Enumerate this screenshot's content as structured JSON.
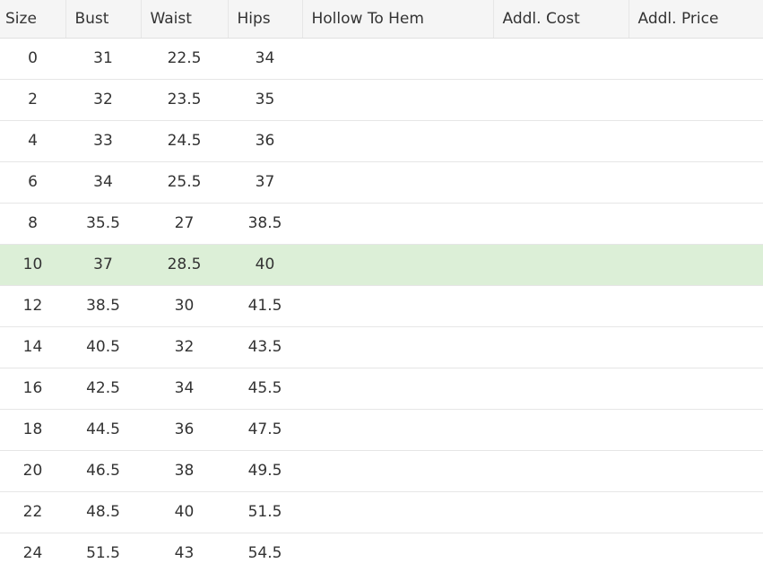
{
  "table": {
    "headers": [
      "Size",
      "Bust",
      "Waist",
      "Hips",
      "Hollow To Hem",
      "Addl. Cost",
      "Addl. Price"
    ],
    "rows": [
      [
        "0",
        "31",
        "22.5",
        "34",
        "",
        "",
        ""
      ],
      [
        "2",
        "32",
        "23.5",
        "35",
        "",
        "",
        ""
      ],
      [
        "4",
        "33",
        "24.5",
        "36",
        "",
        "",
        ""
      ],
      [
        "6",
        "34",
        "25.5",
        "37",
        "",
        "",
        ""
      ],
      [
        "8",
        "35.5",
        "27",
        "38.5",
        "",
        "",
        ""
      ],
      [
        "10",
        "37",
        "28.5",
        "40",
        "",
        "",
        ""
      ],
      [
        "12",
        "38.5",
        "30",
        "41.5",
        "",
        "",
        ""
      ],
      [
        "14",
        "40.5",
        "32",
        "43.5",
        "",
        "",
        ""
      ],
      [
        "16",
        "42.5",
        "34",
        "45.5",
        "",
        "",
        ""
      ],
      [
        "18",
        "44.5",
        "36",
        "47.5",
        "",
        "",
        ""
      ],
      [
        "20",
        "46.5",
        "38",
        "49.5",
        "",
        "",
        ""
      ],
      [
        "22",
        "48.5",
        "40",
        "51.5",
        "",
        "",
        ""
      ],
      [
        "24",
        "51.5",
        "43",
        "54.5",
        "",
        "",
        ""
      ]
    ],
    "highlighted_size": "10",
    "highlight_color": "#dcefd7",
    "header_background": "#f5f5f5"
  }
}
